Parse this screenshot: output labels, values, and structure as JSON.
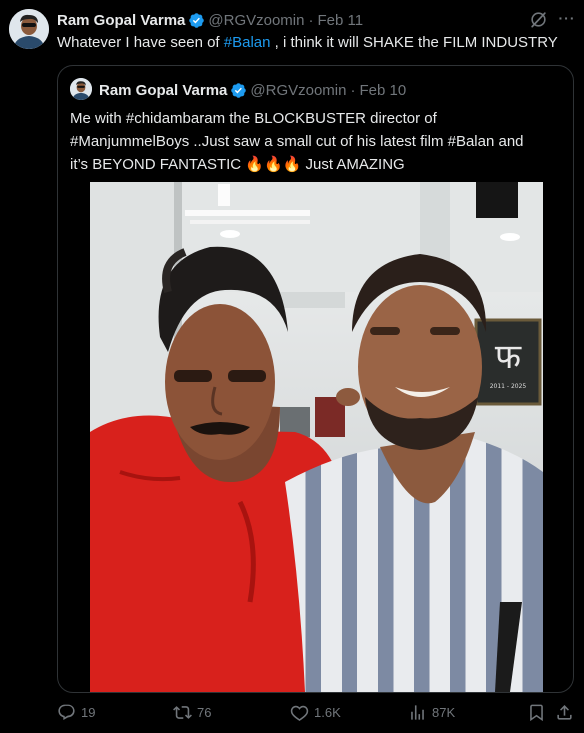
{
  "tweet": {
    "author": {
      "name": "Ram Gopal Varma",
      "handle": "@RGVzoomin",
      "date": "Feb 11"
    },
    "text": {
      "before": "Whatever I have seen of ",
      "hashtag": "#Balan",
      "after": " , i think it will SHAKE the FILM INDUSTRY"
    },
    "quoted": {
      "author": {
        "name": "Ram Gopal Varma",
        "handle": "@RGVzoomin",
        "date": "Feb 10"
      },
      "lines": [
        "Me with #chidambaram the BLOCKBUSTER director of",
        "#ManjummelBoys ..Just saw a small cut of his latest film #Balan and"
      ],
      "line3": {
        "before": "it’s BEYOND FANTASTIC ",
        "emoji": "🔥🔥🔥",
        "after": " Just AMAZING"
      },
      "photo": {
        "board_text": "फ",
        "board_sub": "2011 - 2025"
      }
    },
    "stats": {
      "replies": "19",
      "reposts": "76",
      "likes": "1.6K",
      "views": "87K"
    }
  },
  "icons": {
    "verified": "verified-badge-icon",
    "grok": "grok-icon",
    "more": "more-icon",
    "reply": "reply-icon",
    "repost": "repost-icon",
    "like": "heart-icon",
    "views": "views-icon",
    "bookmark": "bookmark-icon",
    "share": "share-icon"
  },
  "colors": {
    "background": "#000000",
    "text": "#e7e9ea",
    "muted": "#71767b",
    "link": "#1d9bf0",
    "verified": "#1d9bf0",
    "border": "#2f3336"
  }
}
